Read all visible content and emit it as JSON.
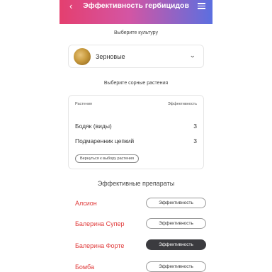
{
  "header": {
    "back_glyph": "‹",
    "title": "Эффективность гербицидов",
    "menu_icon": "hamburger-icon"
  },
  "culture": {
    "label": "Выберите культуру",
    "selected": "Зерновые",
    "chevron": "⌄"
  },
  "weeds": {
    "label": "Выберите сорные растения",
    "col_plant": "Растения",
    "col_eff": "Эффективность",
    "rows": [
      {
        "name": "Бодяк (виды)",
        "value": "3"
      },
      {
        "name": "Подмаренник цепкий",
        "value": "3"
      }
    ],
    "back_button": "Вернуться к выбору растения"
  },
  "products": {
    "title": "Эффективные препараты",
    "button_label": "Эффективность",
    "items": [
      {
        "name": "Алсион",
        "active": false
      },
      {
        "name": "Балерина Супер",
        "active": false
      },
      {
        "name": "Балерина Форте",
        "active": true
      },
      {
        "name": "Бомба",
        "active": false
      }
    ]
  },
  "colors": {
    "accent_red": "#e03a3a",
    "header_gradient": [
      "#e43f6f",
      "#d455a3",
      "#5b6fe0"
    ],
    "active_button": "#3b3b3f"
  }
}
